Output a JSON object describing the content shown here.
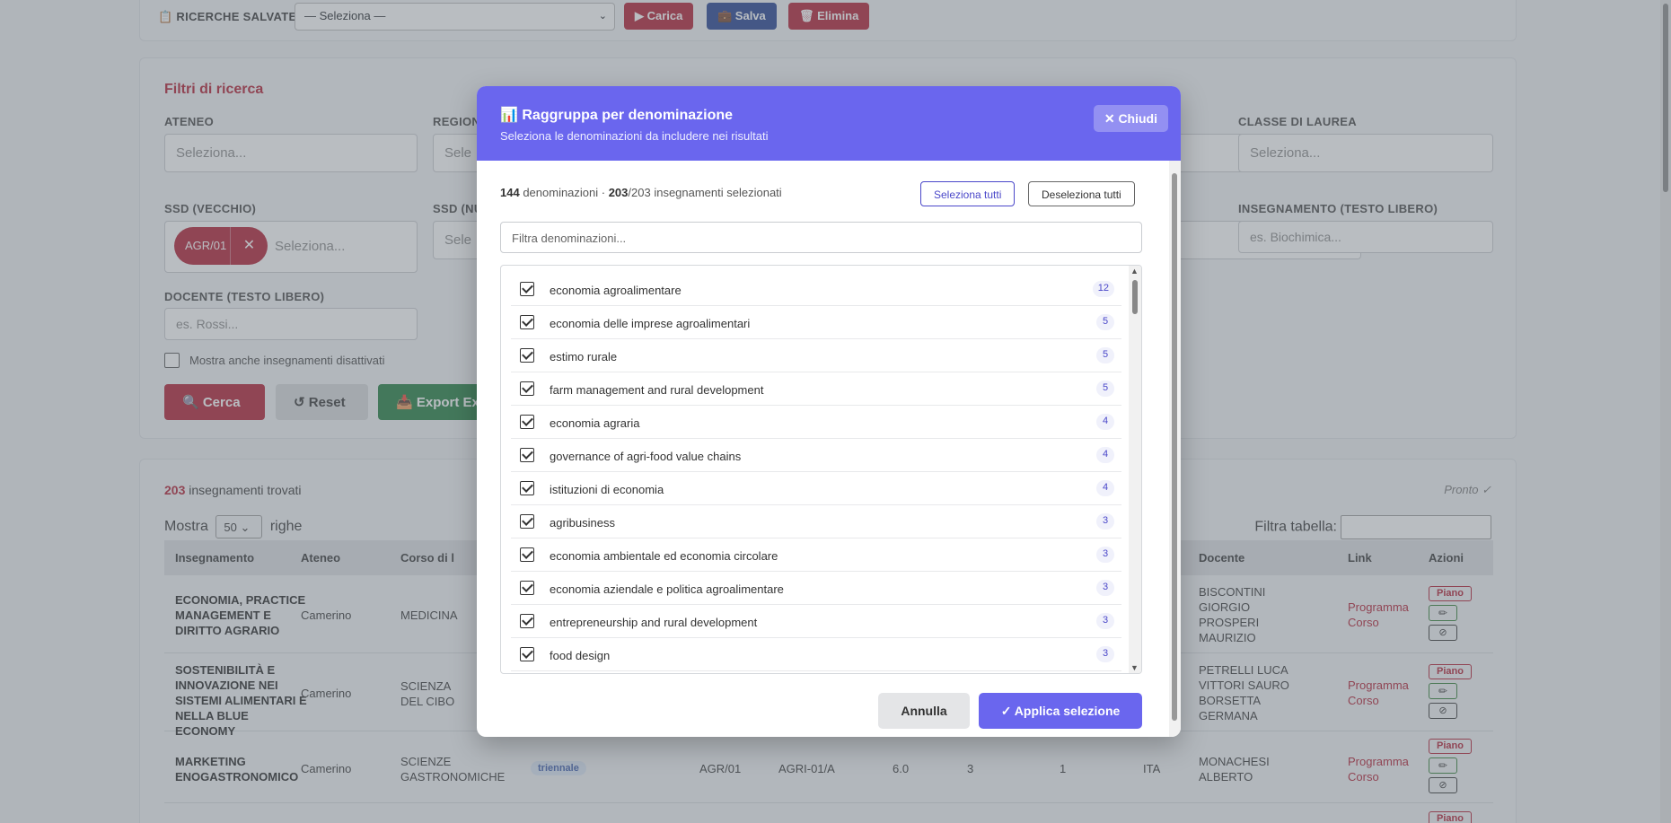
{
  "saved_searches": {
    "label": "📋 RICERCHE SALVATE:",
    "select_value": "— Seleziona —",
    "load_label": "▶ Carica",
    "save_label": "💼 Salva",
    "delete_label": "🗑 Elimina"
  },
  "filters": {
    "title": "Filtri di ricerca",
    "ateneo_label": "ATENEO",
    "ateneo_placeholder": "Seleziona...",
    "regione_label": "REGION",
    "regione_placeholder": "Sele",
    "classe_label": "CLASSE DI LAUREA",
    "classe_placeholder": "Seleziona...",
    "ssd_old_label": "SSD (VECCHIO)",
    "ssd_old_chip": "AGR/01",
    "ssd_old_placeholder": "Seleziona...",
    "ssd_new_label": "SSD (NU",
    "ssd_new_placeholder": "Sele",
    "insegnamento_label": "INSEGNAMENTO (TESTO LIBERO)",
    "insegnamento_placeholder": "es. Biochimica...",
    "docente_label": "DOCENTE (TESTO LIBERO)",
    "docente_placeholder": "es. Rossi...",
    "show_disabled_label": "Mostra anche insegnamenti disattivati",
    "search_label": "🔍 Cerca",
    "reset_label": "↺ Reset",
    "export_label": "📥 Export Ex"
  },
  "results": {
    "count": "203",
    "count_suffix": " insegnamenti trovati",
    "status": "Pronto ✓",
    "show_prefix": "Mostra",
    "page_size": "50",
    "show_suffix": "righe",
    "table_filter_label": "Filtra tabella:",
    "headers": [
      "Insegnamento",
      "Ateneo",
      "Corso di l",
      "Docente",
      "Link",
      "Azioni"
    ],
    "rows": [
      {
        "insegnamento": "ECONOMIA, PRACTICE MANAGEMENT E DIRITTO AGRARIO",
        "ateneo": "Camerino",
        "corso": "MEDICINA",
        "docente": "BISCONTINI GIORGIO PROSPERI MAURIZIO",
        "link": "Programma Corso"
      },
      {
        "insegnamento": "SOSTENIBILITÀ E INNOVAZIONE NEI SISTEMI ALIMENTARI E NELLA BLUE ECONOMY",
        "ateneo": "Camerino",
        "corso": "SCIENZA DEL CIBO",
        "docente": "PETRELLI LUCA VITTORI SAURO BORSETTA GERMANA",
        "link": "Programma Corso"
      },
      {
        "insegnamento": "MARKETING ENOGASTRONOMICO",
        "ateneo": "Camerino",
        "corso": "SCIENZE GASTRONOMICHE",
        "tipo": "triennale",
        "ssd_old": "AGR/01",
        "ssd_new": "AGRI-01/A",
        "cfu": "6.0",
        "col_a": "3",
        "col_b": "1",
        "lingua": "ITA",
        "docente": "MONACHESI ALBERTO",
        "link": "Programma Corso"
      }
    ],
    "action_plan_label": "Piano"
  },
  "modal": {
    "title": "📊 Raggruppa per denominazione",
    "subtitle": "Seleziona le denominazioni da includere nei risultati",
    "close_label": "✕ Chiudi",
    "count_denominazioni": "144",
    "denominazioni_text": " denominazioni · ",
    "selected": "203",
    "total_text": "/203 insegnamenti selezionati",
    "select_all_label": "Seleziona tutti",
    "deselect_all_label": "Deseleziona tutti",
    "filter_placeholder": "Filtra denominazioni...",
    "items": [
      {
        "label": "economia agroalimentare",
        "count": "12"
      },
      {
        "label": "economia delle imprese agroalimentari",
        "count": "5"
      },
      {
        "label": "estimo rurale",
        "count": "5"
      },
      {
        "label": "farm management and rural development",
        "count": "5"
      },
      {
        "label": "economia agraria",
        "count": "4"
      },
      {
        "label": "governance of agri-food value chains",
        "count": "4"
      },
      {
        "label": "istituzioni di economia",
        "count": "4"
      },
      {
        "label": "agribusiness",
        "count": "3"
      },
      {
        "label": "economia ambientale ed economia circolare",
        "count": "3"
      },
      {
        "label": "economia aziendale e politica agroalimentare",
        "count": "3"
      },
      {
        "label": "entrepreneurship and rural development",
        "count": "3"
      },
      {
        "label": "food design",
        "count": "3"
      }
    ],
    "cancel_label": "Annulla",
    "apply_label": "✓ Applica selezione"
  },
  "colors": {
    "accent_red": "#b01a2e",
    "modal_purple": "#6a66ee",
    "save_blue": "#1f3d8f",
    "export_green": "#1e7b3d"
  }
}
